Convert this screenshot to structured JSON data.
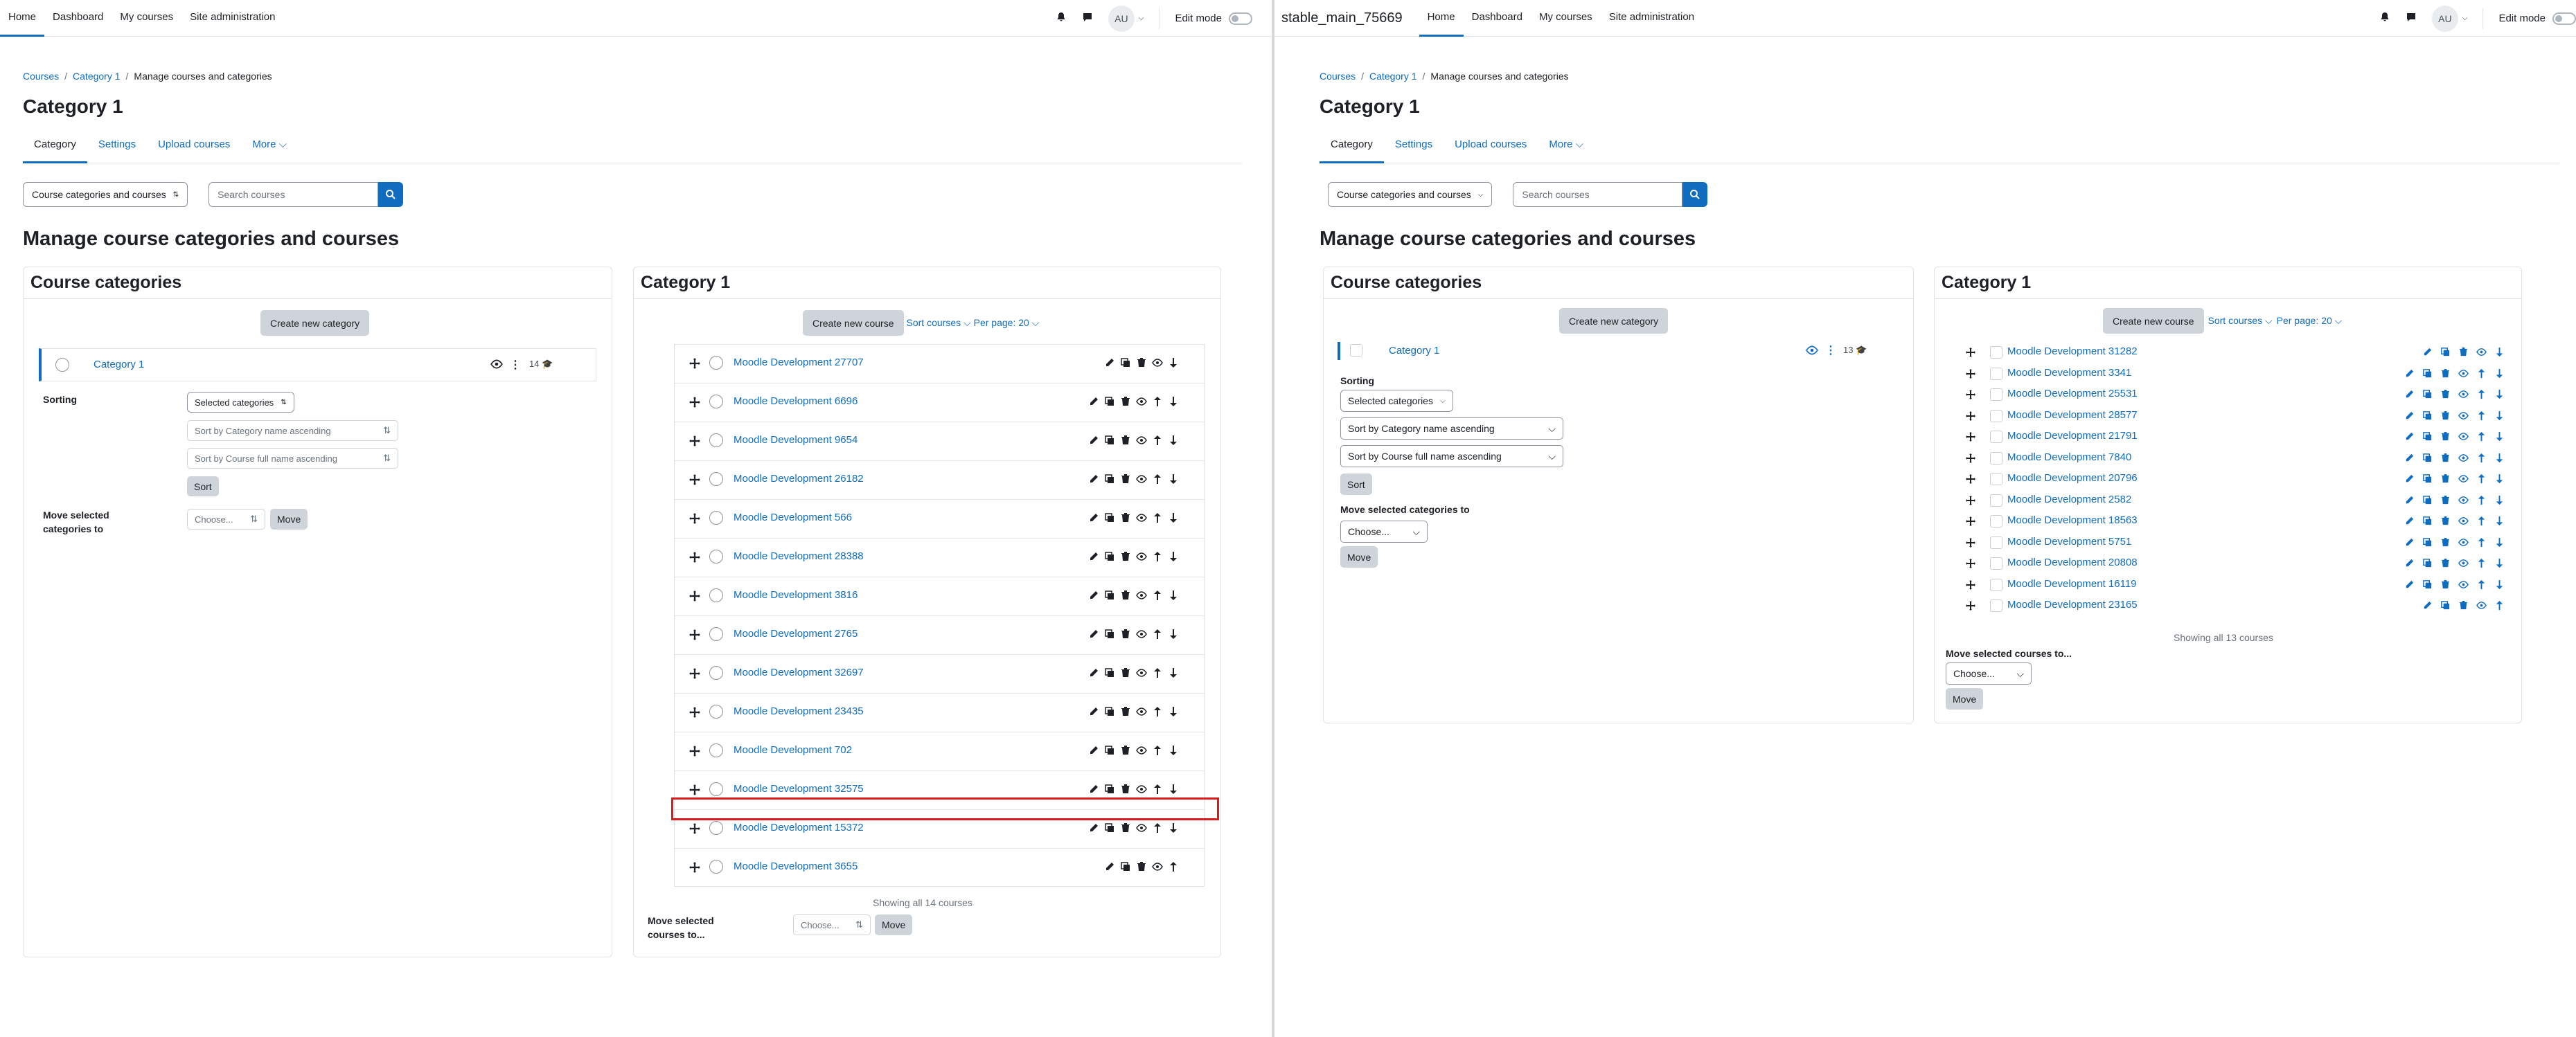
{
  "left": {
    "nav": {
      "items": [
        "Home",
        "Dashboard",
        "My courses",
        "Site administration"
      ],
      "avatar": "AU",
      "edit_mode": "Edit mode"
    },
    "breadcrumb": [
      "Courses",
      "Category 1",
      "Manage courses and categories"
    ],
    "title": "Category 1",
    "tabs": [
      "Category",
      "Settings",
      "Upload courses",
      "More"
    ],
    "view_select": "Course categories and courses",
    "search_placeholder": "Search courses",
    "heading": "Manage course categories and courses",
    "cat_card": {
      "title": "Course categories",
      "create_btn": "Create new category",
      "category": "Category 1",
      "count": "14",
      "sorting_label": "Sorting",
      "sort_select": "Selected categories",
      "sort_opt1": "Sort by Category name ascending",
      "sort_opt2": "Sort by Course full name ascending",
      "sort_btn": "Sort",
      "move_label": "Move selected categories to",
      "move_select": "Choose...",
      "move_btn": "Move"
    },
    "course_card": {
      "title": "Category 1",
      "create_btn": "Create new course",
      "sort_link": "Sort courses",
      "perpage_link": "Per page: 20",
      "courses": [
        "Moodle Development 27707",
        "Moodle Development 6696",
        "Moodle Development 9654",
        "Moodle Development 26182",
        "Moodle Development 566",
        "Moodle Development 28388",
        "Moodle Development 3816",
        "Moodle Development 2765",
        "Moodle Development 32697",
        "Moodle Development 23435",
        "Moodle Development 702",
        "Moodle Development 32575",
        "Moodle Development 15372",
        "Moodle Development 3655"
      ],
      "showing": "Showing all 14 courses",
      "move_label": "Move selected courses to...",
      "move_select": "Choose...",
      "move_btn": "Move"
    }
  },
  "right": {
    "site_name": "stable_main_75669",
    "nav": {
      "items": [
        "Home",
        "Dashboard",
        "My courses",
        "Site administration"
      ],
      "avatar": "AU",
      "edit_mode": "Edit mode"
    },
    "breadcrumb": [
      "Courses",
      "Category 1",
      "Manage courses and categories"
    ],
    "title": "Category 1",
    "tabs": [
      "Category",
      "Settings",
      "Upload courses",
      "More"
    ],
    "view_select": "Course categories and courses",
    "search_placeholder": "Search courses",
    "heading": "Manage course categories and courses",
    "cat_card": {
      "title": "Course categories",
      "create_btn": "Create new category",
      "category": "Category 1",
      "count": "13",
      "sorting_label": "Sorting",
      "sort_select": "Selected categories",
      "sort_opt1": "Sort by Category name ascending",
      "sort_opt2": "Sort by Course full name ascending",
      "sort_btn": "Sort",
      "move_label": "Move selected categories to",
      "move_select": "Choose...",
      "move_btn": "Move"
    },
    "course_card": {
      "title": "Category 1",
      "create_btn": "Create new course",
      "sort_link": "Sort courses",
      "perpage_link": "Per page: 20",
      "courses": [
        "Moodle Development 31282",
        "Moodle Development 3341",
        "Moodle Development 25531",
        "Moodle Development 28577",
        "Moodle Development 21791",
        "Moodle Development 7840",
        "Moodle Development 20796",
        "Moodle Development 2582",
        "Moodle Development 18563",
        "Moodle Development 5751",
        "Moodle Development 20808",
        "Moodle Development 16119",
        "Moodle Development 23165"
      ],
      "showing": "Showing all 13 courses",
      "move_label": "Move selected courses to...",
      "move_select": "Choose...",
      "move_btn": "Move"
    }
  },
  "colors": {
    "link": "#0f6cbf",
    "highlight": "#d91a1a"
  }
}
